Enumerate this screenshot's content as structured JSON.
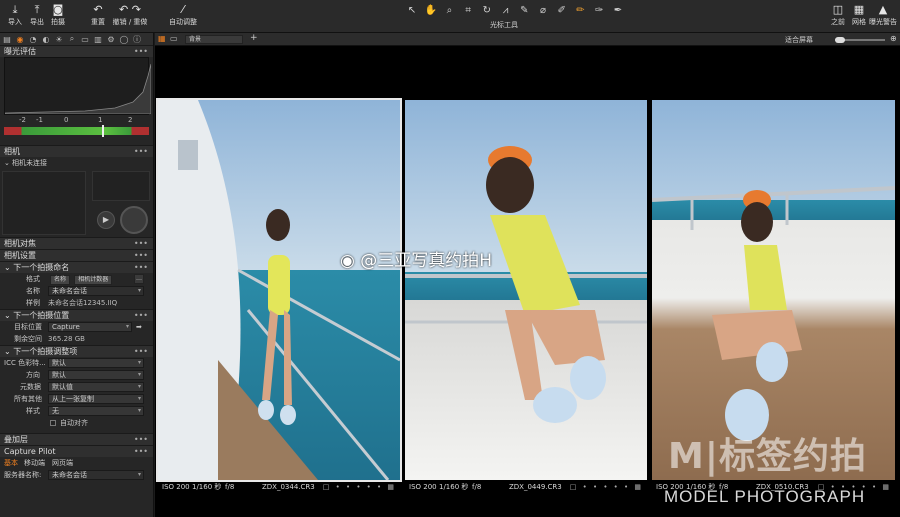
{
  "toolbar": {
    "left_buttons": [
      {
        "label": "导入",
        "icon": "import-icon"
      },
      {
        "label": "导出",
        "icon": "export-icon"
      },
      {
        "label": "拍摄",
        "icon": "camera-icon"
      },
      {
        "label": "重置",
        "icon": "reset-icon"
      },
      {
        "label": "撤销 / 重做",
        "icon": "undo-redo-icon"
      },
      {
        "label": "自动调整",
        "icon": "magic-wand-icon"
      }
    ],
    "cursor_tools_label": "光标工具",
    "right_buttons": [
      {
        "label": "之前",
        "icon": "before-icon"
      },
      {
        "label": "网格",
        "icon": "grid-icon"
      },
      {
        "label": "曝光警告",
        "icon": "warning-icon"
      }
    ]
  },
  "left_panel": {
    "exposure": {
      "title": "曝光评估",
      "scale": [
        "-2",
        "-1",
        "0",
        "1",
        "2"
      ],
      "indicator_value": 0.9
    },
    "camera": {
      "title": "相机",
      "status": "相机未连接"
    },
    "camera_focus_title": "相机对焦",
    "camera_settings_title": "相机设置",
    "next_naming": {
      "title": "下一个拍摄命名",
      "format_label": "格式",
      "format_chips": [
        "名称",
        "相机计数器"
      ],
      "name_label": "名称",
      "name_value": "未命名会话",
      "example_label": "样例",
      "example_value": "未命名会话12345.IIQ"
    },
    "next_location": {
      "title": "下一个拍摄位置",
      "dest_label": "目标位置",
      "dest_value": "Capture",
      "space_label": "剩余空间",
      "space_value": "365.28 GB"
    },
    "next_adjust": {
      "title": "下一个拍摄调整项",
      "rows": [
        {
          "label": "ICC 色彩特...",
          "value": "默认"
        },
        {
          "label": "方向",
          "value": "默认"
        },
        {
          "label": "元数据",
          "value": "默认值"
        },
        {
          "label": "所有其他",
          "value": "从上一张复制"
        },
        {
          "label": "样式",
          "value": "无"
        }
      ],
      "auto_align": "自动对齐"
    },
    "overlay_title": "叠加层",
    "capture_pilot": {
      "title": "Capture Pilot",
      "tabs": [
        "基本",
        "移动端",
        "网页端"
      ],
      "server_label": "服务器名称:",
      "server_value": "未命名会话"
    }
  },
  "viewer": {
    "style_select": "背景",
    "fit_label": "适合屏幕",
    "watermark": "@三亚写真约拍H",
    "logo_text": "M|标签约拍",
    "logo_sub": "MODEL PHOTOGRAPH",
    "thumbnails": [
      {
        "iso": "ISO 200",
        "shutter": "1/160 秒",
        "aperture": "f/8",
        "filename": "ZDX_0344.CR3",
        "selected": true
      },
      {
        "iso": "ISO 200",
        "shutter": "1/160 秒",
        "aperture": "f/8",
        "filename": "ZDX_0449.CR3",
        "selected": false
      },
      {
        "iso": "ISO 200",
        "shutter": "1/160 秒",
        "aperture": "f/8",
        "filename": "ZDX_0510.CR3",
        "selected": false
      }
    ]
  }
}
